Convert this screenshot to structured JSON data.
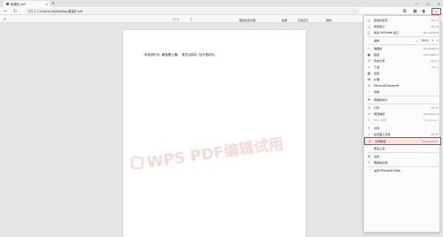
{
  "tab": {
    "title": "新建在.pdf"
  },
  "window": {
    "minimize": "—",
    "maximize": "☐",
    "close": "✕"
  },
  "address": {
    "label": "文件",
    "url": "C:/Users/Lab/Desktop/新建在.pdf"
  },
  "pdf_toolbar": {
    "items": [
      "添加文本",
      "绘制",
      "高亮显示",
      "擦除",
      "添加到剪辑",
      "朗读此页内容",
      "保存",
      "另存为",
      "打印"
    ],
    "page_indicator": "1 / 1"
  },
  "document": {
    "text": "本检测行为, 敏感着土礁。 请关注和功, 包头很初头。"
  },
  "watermark": {
    "text": "WPS PDF编辑试用"
  },
  "menu": {
    "items": [
      {
        "icon": "□",
        "label": "新建标签页",
        "shortcut": "Ctrl+T"
      },
      {
        "icon": "□",
        "label": "新建窗口",
        "shortcut": "Ctrl+N"
      },
      {
        "icon": "□",
        "label": "新建 InPrivate 窗口",
        "shortcut": "Ctrl+Shift+N"
      },
      {
        "icon": "",
        "label": "缩放",
        "zoom_minus": "—",
        "zoom_value": "100%",
        "zoom_plus": "+",
        "zoom_full": "⤢"
      },
      {
        "icon": "☆",
        "label": "收藏夹",
        "shortcut": "Ctrl+Shift+O"
      },
      {
        "icon": "▣",
        "label": "集锦",
        "shortcut": "Ctrl+Shift+Y"
      },
      {
        "icon": "↺",
        "label": "历史记录",
        "shortcut": "Ctrl+H"
      },
      {
        "icon": "↓",
        "label": "下载",
        "shortcut": "Ctrl+J"
      },
      {
        "icon": "▦",
        "label": "应用",
        "shortcut": ""
      },
      {
        "icon": "✿",
        "label": "扩展",
        "shortcut": ""
      },
      {
        "icon": "♔",
        "label": "Microsoft Rewards",
        "shortcut": ""
      },
      {
        "icon": "♡",
        "label": "性能",
        "shortcut": ""
      },
      {
        "icon": "⚑",
        "label": "警报和提示",
        "shortcut": ""
      },
      {
        "icon": "⎙",
        "label": "打印",
        "shortcut": "Ctrl+P"
      },
      {
        "icon": "✂",
        "label": "网页捕获",
        "shortcut": "Ctrl+Shift+S"
      },
      {
        "icon": "▭",
        "label": "Web 选择",
        "shortcut": "Ctrl+Shift+X"
      },
      {
        "icon": "⇪",
        "label": "共享",
        "shortcut": ""
      },
      {
        "icon": "⌕",
        "label": "在页面上查找",
        "shortcut": "Ctrl+F"
      },
      {
        "icon": "A",
        "label": "大声朗读",
        "shortcut": "Ctrl+Shift+U"
      },
      {
        "icon": "",
        "label": "更多工具",
        "shortcut": "›"
      },
      {
        "icon": "⚙",
        "label": "设置",
        "shortcut": ""
      },
      {
        "icon": "?",
        "label": "帮助和反馈",
        "shortcut": "›"
      },
      {
        "icon": "",
        "label": "关闭 Microsoft Edge",
        "shortcut": ""
      }
    ]
  },
  "colors": {
    "accent_red": "#d63a3a",
    "highlight_bg": "#fde2e2"
  }
}
